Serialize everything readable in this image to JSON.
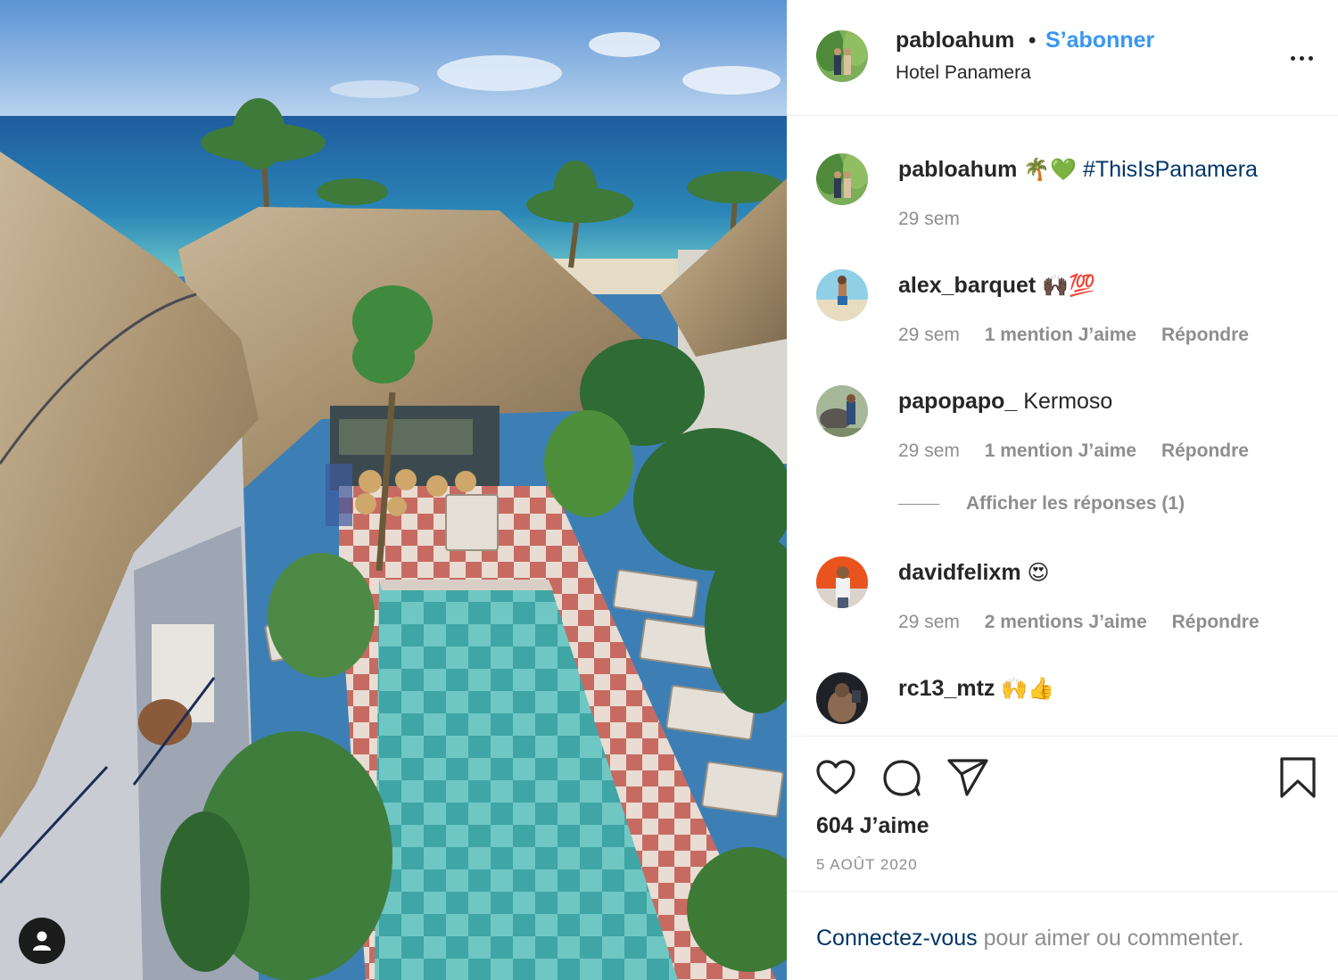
{
  "post": {
    "username": "pabloahum",
    "separator": "•",
    "follow_label": "S’abonner",
    "location": "Hotel Panamera"
  },
  "comments": [
    {
      "username": "pabloahum",
      "text": "",
      "emoji": "🌴💚",
      "hashtag": "#ThisIsPanamera",
      "time": "29 sem",
      "likes": "",
      "reply": ""
    },
    {
      "username": "alex_barquet",
      "text": "",
      "emoji": "🙌🏿💯",
      "hashtag": "",
      "time": "29 sem",
      "likes": "1 mention J’aime",
      "reply": "Répondre"
    },
    {
      "username": "papopapo_",
      "text": "Kermoso",
      "emoji": "",
      "hashtag": "",
      "time": "29 sem",
      "likes": "1 mention J’aime",
      "reply": "Répondre"
    },
    {
      "username": "davidfelixm",
      "text": "",
      "emoji": "😍",
      "hashtag": "",
      "time": "29 sem",
      "likes": "2 mentions J’aime",
      "reply": "Répondre"
    },
    {
      "username": "rc13_mtz",
      "text": "",
      "emoji": "🙌👍",
      "hashtag": "",
      "time": "",
      "likes": "",
      "reply": ""
    }
  ],
  "view_replies": "Afficher les réponses (1)",
  "likes_count": "604 J’aime",
  "date": "5 AOÛT 2020",
  "login": {
    "link": "Connectez-vous",
    "rest": " pour aimer ou commenter."
  },
  "colors": {
    "link_blue": "#3897f0",
    "hashtag_blue": "#003569",
    "muted_gray": "#8e8e8e",
    "text": "#262626"
  },
  "icons": [
    "heart-icon",
    "comment-icon",
    "share-icon",
    "bookmark-icon",
    "more-icon",
    "user-tag-icon"
  ]
}
